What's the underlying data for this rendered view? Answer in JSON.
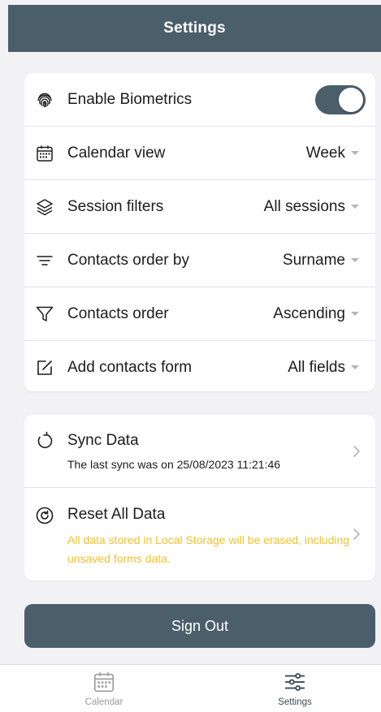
{
  "header": {
    "title": "Settings"
  },
  "settings": {
    "biometrics": {
      "label": "Enable Biometrics",
      "enabled": true,
      "icon": "fingerprint-icon"
    },
    "calendar_view": {
      "label": "Calendar view",
      "value": "Week",
      "icon": "calendar-icon"
    },
    "session_filters": {
      "label": "Session filters",
      "value": "All sessions",
      "icon": "layers-icon"
    },
    "contacts_order_by": {
      "label": "Contacts order by",
      "value": "Surname",
      "icon": "sort-lines-icon"
    },
    "contacts_order": {
      "label": "Contacts order",
      "value": "Ascending",
      "icon": "filter-icon"
    },
    "add_contacts_form": {
      "label": "Add contacts form",
      "value": "All fields",
      "icon": "edit-icon"
    }
  },
  "data_actions": {
    "sync": {
      "title": "Sync Data",
      "subtitle": "The last sync was on 25/08/2023 11:21:46",
      "icon": "sync-icon"
    },
    "reset": {
      "title": "Reset All Data",
      "warning": "All data stored in Local Storage will be erased, including unsaved forms data.",
      "icon": "reset-icon"
    }
  },
  "sign_out": {
    "label": "Sign Out"
  },
  "tabbar": {
    "calendar": {
      "label": "Calendar",
      "icon": "calendar-icon"
    },
    "settings": {
      "label": "Settings",
      "icon": "sliders-icon",
      "active": true
    }
  },
  "colors": {
    "primary": "#4b5f6b",
    "warning": "#f2c230",
    "background": "#f2f2f4"
  }
}
